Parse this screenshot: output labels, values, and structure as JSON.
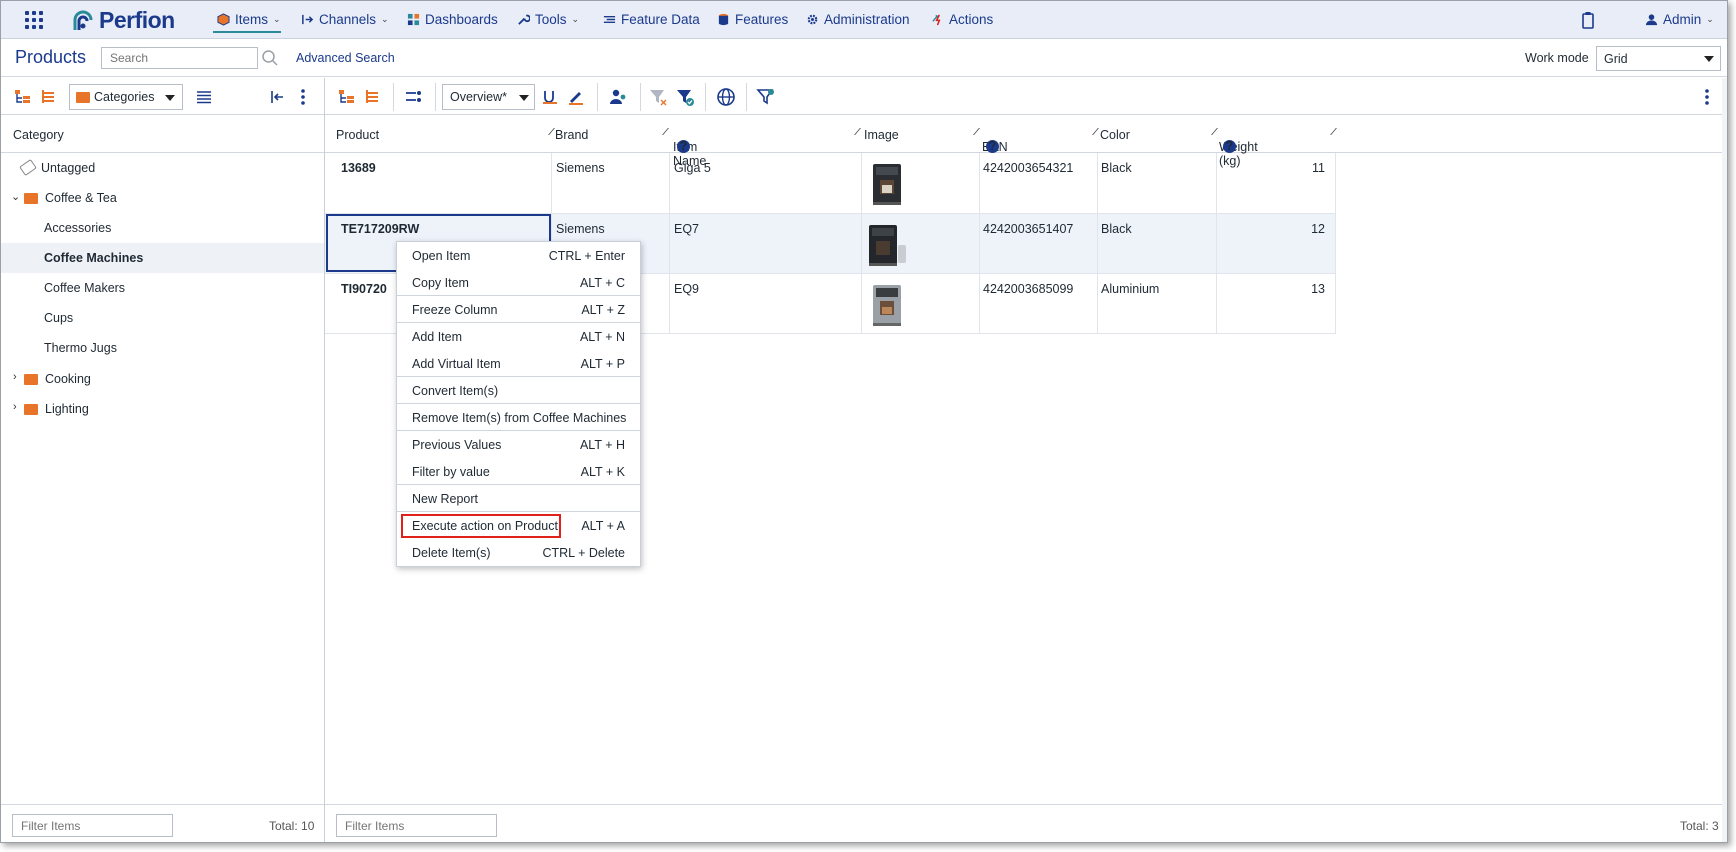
{
  "nav": {
    "brand": "Perfion",
    "items": [
      {
        "label": "Items",
        "has_chevron": true
      },
      {
        "label": "Channels",
        "has_chevron": true
      },
      {
        "label": "Dashboards",
        "has_chevron": false
      },
      {
        "label": "Tools",
        "has_chevron": true
      },
      {
        "label": "Feature Data",
        "has_chevron": false
      },
      {
        "label": "Features",
        "has_chevron": false
      },
      {
        "label": "Administration",
        "has_chevron": false
      },
      {
        "label": "Actions",
        "has_chevron": false
      }
    ],
    "user": "Admin",
    "chevron": "⌄"
  },
  "products_bar": {
    "title": "Products",
    "search_placeholder": "Search",
    "advanced_search": "Advanced Search",
    "work_mode_label": "Work mode",
    "work_mode_value": "Grid"
  },
  "toolbar": {
    "category_select": "Categories",
    "view_select": "Overview*"
  },
  "tree": {
    "header": "Category",
    "items": [
      {
        "label": "Untagged",
        "icon": "tag-icon",
        "indent": 0
      },
      {
        "label": "Coffee & Tea",
        "icon": "folder-icon",
        "expanded": true
      },
      {
        "label": "Accessories"
      },
      {
        "label": "Coffee Machines",
        "selected": true
      },
      {
        "label": "Coffee Makers"
      },
      {
        "label": "Cups"
      },
      {
        "label": "Thermo Jugs"
      },
      {
        "label": "Cooking",
        "icon": "folder-icon",
        "expanded": false
      },
      {
        "label": "Lighting",
        "icon": "folder-icon",
        "expanded": false
      }
    ],
    "filter_placeholder": "Filter Items",
    "total": "Total: 10"
  },
  "grid": {
    "columns": [
      {
        "label": "Product"
      },
      {
        "label": "Brand"
      },
      {
        "label": "Item Name",
        "help": true
      },
      {
        "label": "Image"
      },
      {
        "label": "EAN",
        "help": true
      },
      {
        "label": "Color"
      },
      {
        "label": "Weight (kg)",
        "help": true
      }
    ],
    "rows": [
      {
        "product": "13689",
        "brand": "Siemens",
        "item_name": "Giga 5",
        "ean": "4242003654321",
        "color": "Black",
        "weight": "11"
      },
      {
        "product": "TE717209RW",
        "brand": "Siemens",
        "item_name": "EQ7",
        "ean": "4242003651407",
        "color": "Black",
        "weight": "12"
      },
      {
        "product": "TI90720",
        "brand": "",
        "item_name": "EQ9",
        "ean": "4242003685099",
        "color": "Aluminium",
        "weight": "13"
      }
    ],
    "help_glyph": "?",
    "filter_placeholder": "Filter Items",
    "total": "Total: 3"
  },
  "context_menu": {
    "items": [
      {
        "label": "Open Item",
        "shortcut": "CTRL + Enter"
      },
      {
        "label": "Copy Item",
        "shortcut": "ALT + C"
      },
      {
        "label": "Freeze Column",
        "shortcut": "ALT + Z"
      },
      {
        "label": "Add Item",
        "shortcut": "ALT + N"
      },
      {
        "label": "Add Virtual Item",
        "shortcut": "ALT + P"
      },
      {
        "label": "Convert Item(s)",
        "shortcut": ""
      },
      {
        "label": "Remove Item(s) from Coffee Machines",
        "shortcut": ""
      },
      {
        "label": "Previous Values",
        "shortcut": "ALT + H"
      },
      {
        "label": "Filter by value",
        "shortcut": "ALT + K"
      },
      {
        "label": "New Report",
        "shortcut": ""
      },
      {
        "label": "Execute action on Product",
        "shortcut": "ALT + A",
        "highlighted": true
      },
      {
        "label": "Delete Item(s)",
        "shortcut": "CTRL + Delete"
      }
    ]
  },
  "colors": {
    "brand": "#1b3a8c",
    "accent": "#2b8a9a",
    "folder": "#e8742a",
    "highlight": "#e0201b"
  }
}
